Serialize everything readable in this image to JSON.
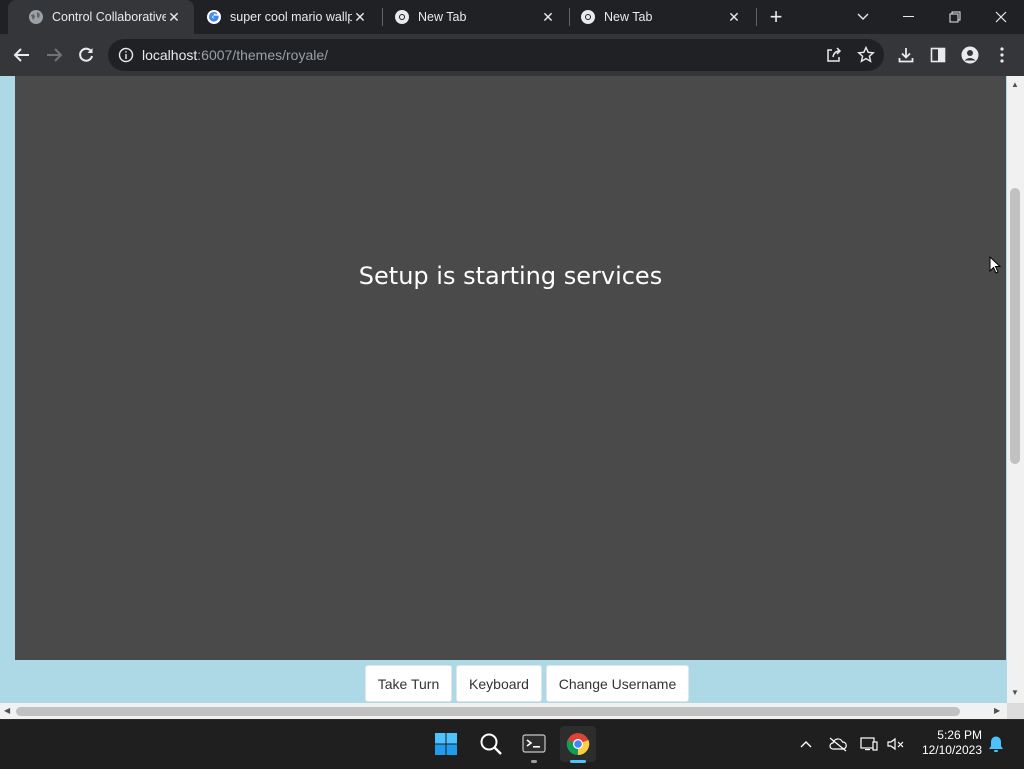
{
  "browser": {
    "tabs": [
      {
        "title": "Control Collaborative V",
        "active": true,
        "favicon": "globe-icon"
      },
      {
        "title": "super cool mario wallp",
        "active": false,
        "favicon": "google-icon"
      },
      {
        "title": "New Tab",
        "active": false,
        "favicon": "chrome-icon"
      },
      {
        "title": "New Tab",
        "active": false,
        "favicon": "chrome-icon"
      }
    ],
    "close_glyph": "✕",
    "new_tab_glyph": "+",
    "address": {
      "host": "localhost",
      "path": ":6007/themes/royale/"
    }
  },
  "page": {
    "status_text": "Setup is starting services",
    "buttons": {
      "take_turn": "Take Turn",
      "keyboard": "Keyboard",
      "change_username": "Change Username"
    },
    "scroll": {
      "vertical_fraction": 0.3,
      "horizontal_fraction": 0.0
    }
  },
  "taskbar": {
    "time": "5:26 PM",
    "date": "12/10/2023"
  },
  "colors": {
    "page_bg": "#add8e6",
    "screen_bg": "#4a4a4a",
    "chrome_dark": "#202124",
    "chrome_toolbar": "#35363a"
  }
}
